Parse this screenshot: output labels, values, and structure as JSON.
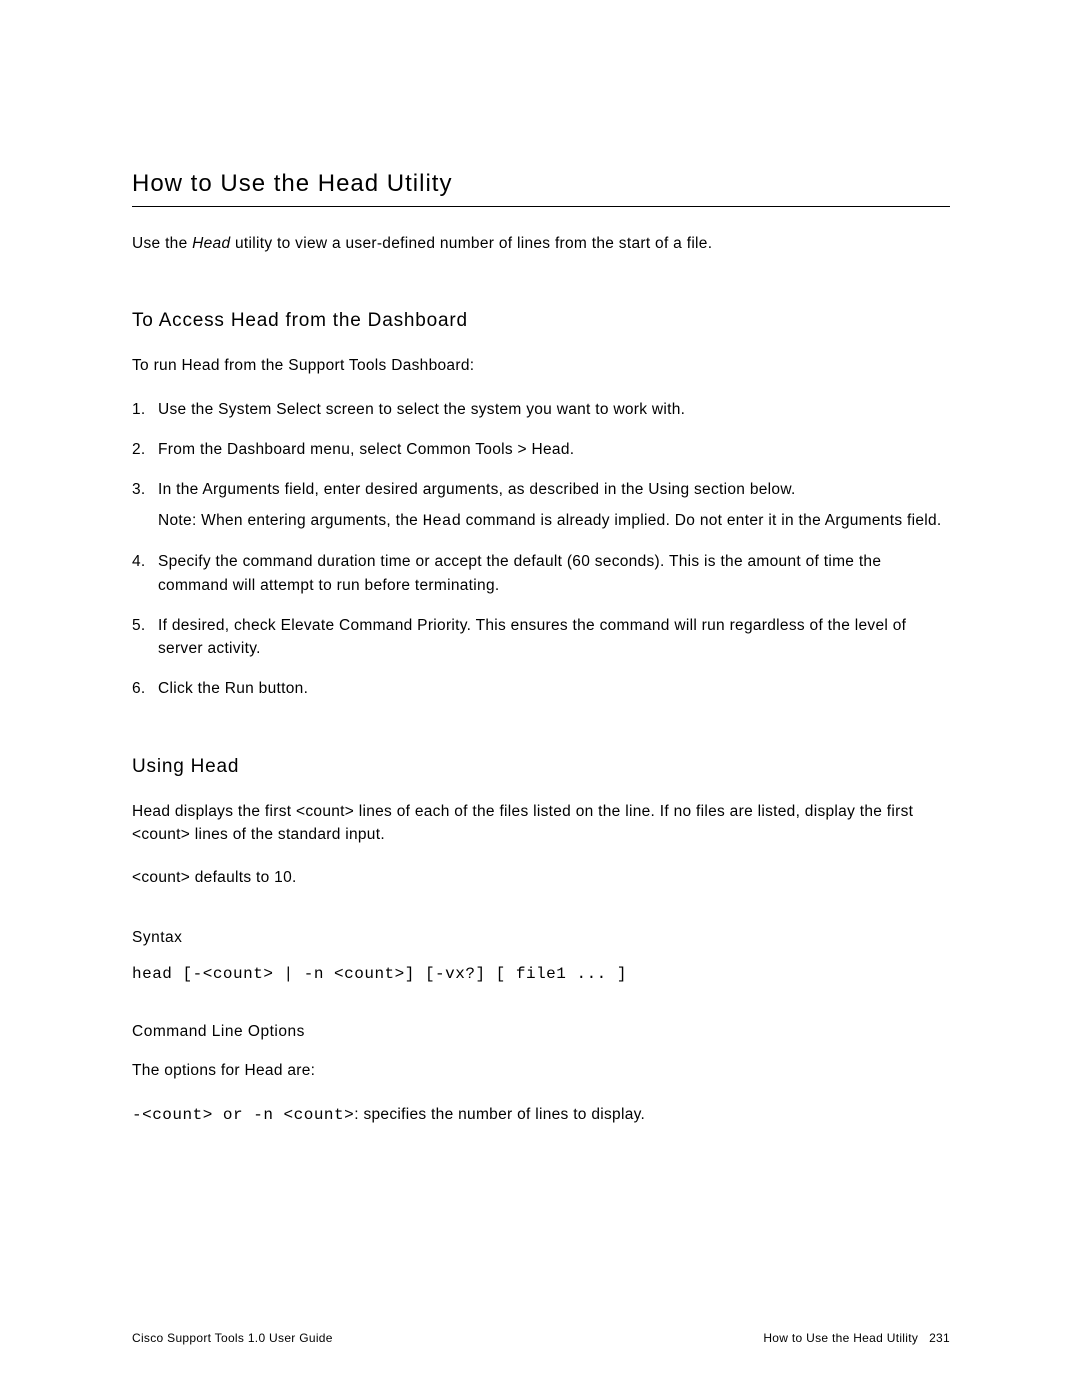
{
  "page": {
    "title": "How to Use the Head Utility",
    "intro_pre": "Use the ",
    "intro_italic": "Head",
    "intro_post": " utility to view a user-defined number of lines from the start of a file.",
    "section_access": {
      "heading": "To Access Head from the Dashboard",
      "intro": "To run Head from the Support Tools Dashboard:",
      "items": [
        "Use the System Select screen to select the system you want to work with.",
        "From the Dashboard menu, select Common Tools > Head.",
        "In the Arguments field, enter desired arguments, as described in the Using section below.",
        "Specify the command duration time or accept the default (60 seconds). This is the amount of time the command will attempt to run before terminating.",
        "If desired, check Elevate Command Priority. This ensures the command will run regardless of the level of server activity.",
        "Click the Run button."
      ],
      "note_pre": "Note: When entering arguments, the ",
      "note_mono": "Head",
      "note_post": " command is already implied. Do not enter it in the Arguments field."
    },
    "section_using": {
      "heading": "Using Head",
      "para1": "Head displays the first <count> lines of each of the files listed on the line. If no files are listed, display the first <count> lines of the standard input.",
      "para2": "<count> defaults to 10.",
      "syntax_heading": "Syntax",
      "syntax_line": "head [-<count> | -n <count>] [-vx?] [ file1 ... ]",
      "options_heading": "Command Line Options",
      "options_intro": "The options for Head are:",
      "option1_mono": "-<count> or -n <count>",
      "option1_post": ": specifies the number of lines to display."
    }
  },
  "footer": {
    "left": "Cisco Support Tools 1.0 User Guide",
    "right_title": "How to Use the Head Utility",
    "right_page": "231"
  }
}
